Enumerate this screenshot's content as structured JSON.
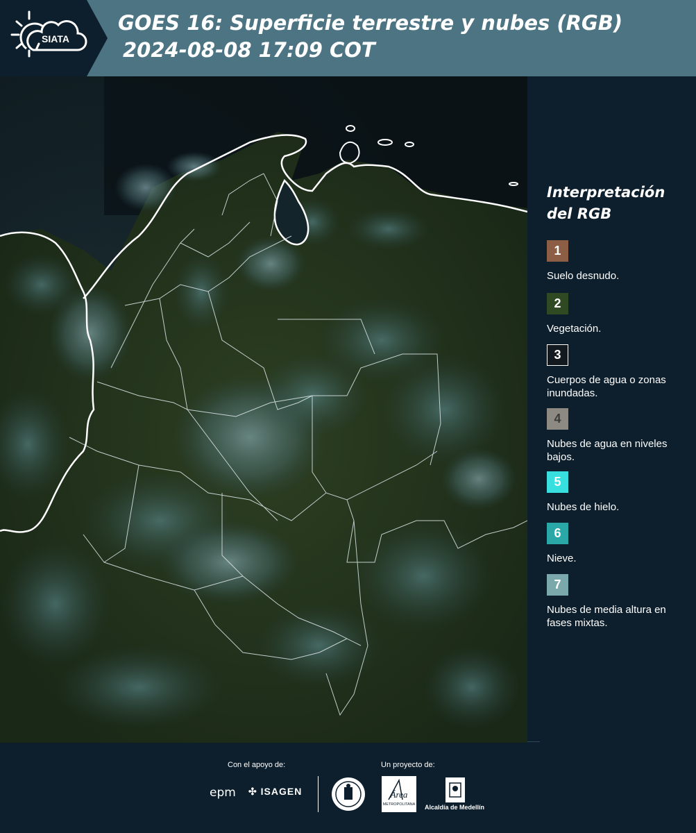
{
  "header": {
    "logo_text": "SIATA",
    "title_line1": "GOES 16: Superficie terrestre y nubes (RGB)",
    "title_line2": "2024-08-08 17:09 COT"
  },
  "legend": {
    "title": "Interpretación del RGB",
    "items": [
      {
        "number": "1",
        "label": "Suelo desnudo.",
        "color": "#8b5e45",
        "text_color": "#ffffff"
      },
      {
        "number": "2",
        "label": "Vegetación.",
        "color": "#2f4a22",
        "text_color": "#ffffff"
      },
      {
        "number": "3",
        "label": "Cuerpos de agua o zonas inundadas.",
        "color": "#121a20",
        "text_color": "#ffffff",
        "border": "#ffffff"
      },
      {
        "number": "4",
        "label": "Nubes de agua en niveles bajos.",
        "color": "#8c8a82",
        "text_color": "#3c3c3c"
      },
      {
        "number": "5",
        "label": "Nubes de hielo.",
        "color": "#37e0df",
        "text_color": "#ffffff"
      },
      {
        "number": "6",
        "label": "Nieve.",
        "color": "#2aa8a7",
        "text_color": "#ffffff"
      },
      {
        "number": "7",
        "label": "Nubes de media altura en fases mixtas.",
        "color": "#7ba9ab",
        "text_color": "#ffffff"
      }
    ]
  },
  "footer": {
    "support_label": "Con el apoyo de:",
    "project_label": "Un proyecto de:",
    "support_logos": [
      "epm",
      "ISAGEN"
    ],
    "project_logos": [
      "Área Metropolitana Valle de Aburrá",
      "Alcaldía de Medellín"
    ],
    "alcaldia_text": "Alcaldía de Medellín",
    "area_text": "METROPOLITANA"
  },
  "colors": {
    "header_bg": "#4d7483",
    "logo_bg": "#0d1f2c",
    "page_bg": "#0d1f2c"
  }
}
